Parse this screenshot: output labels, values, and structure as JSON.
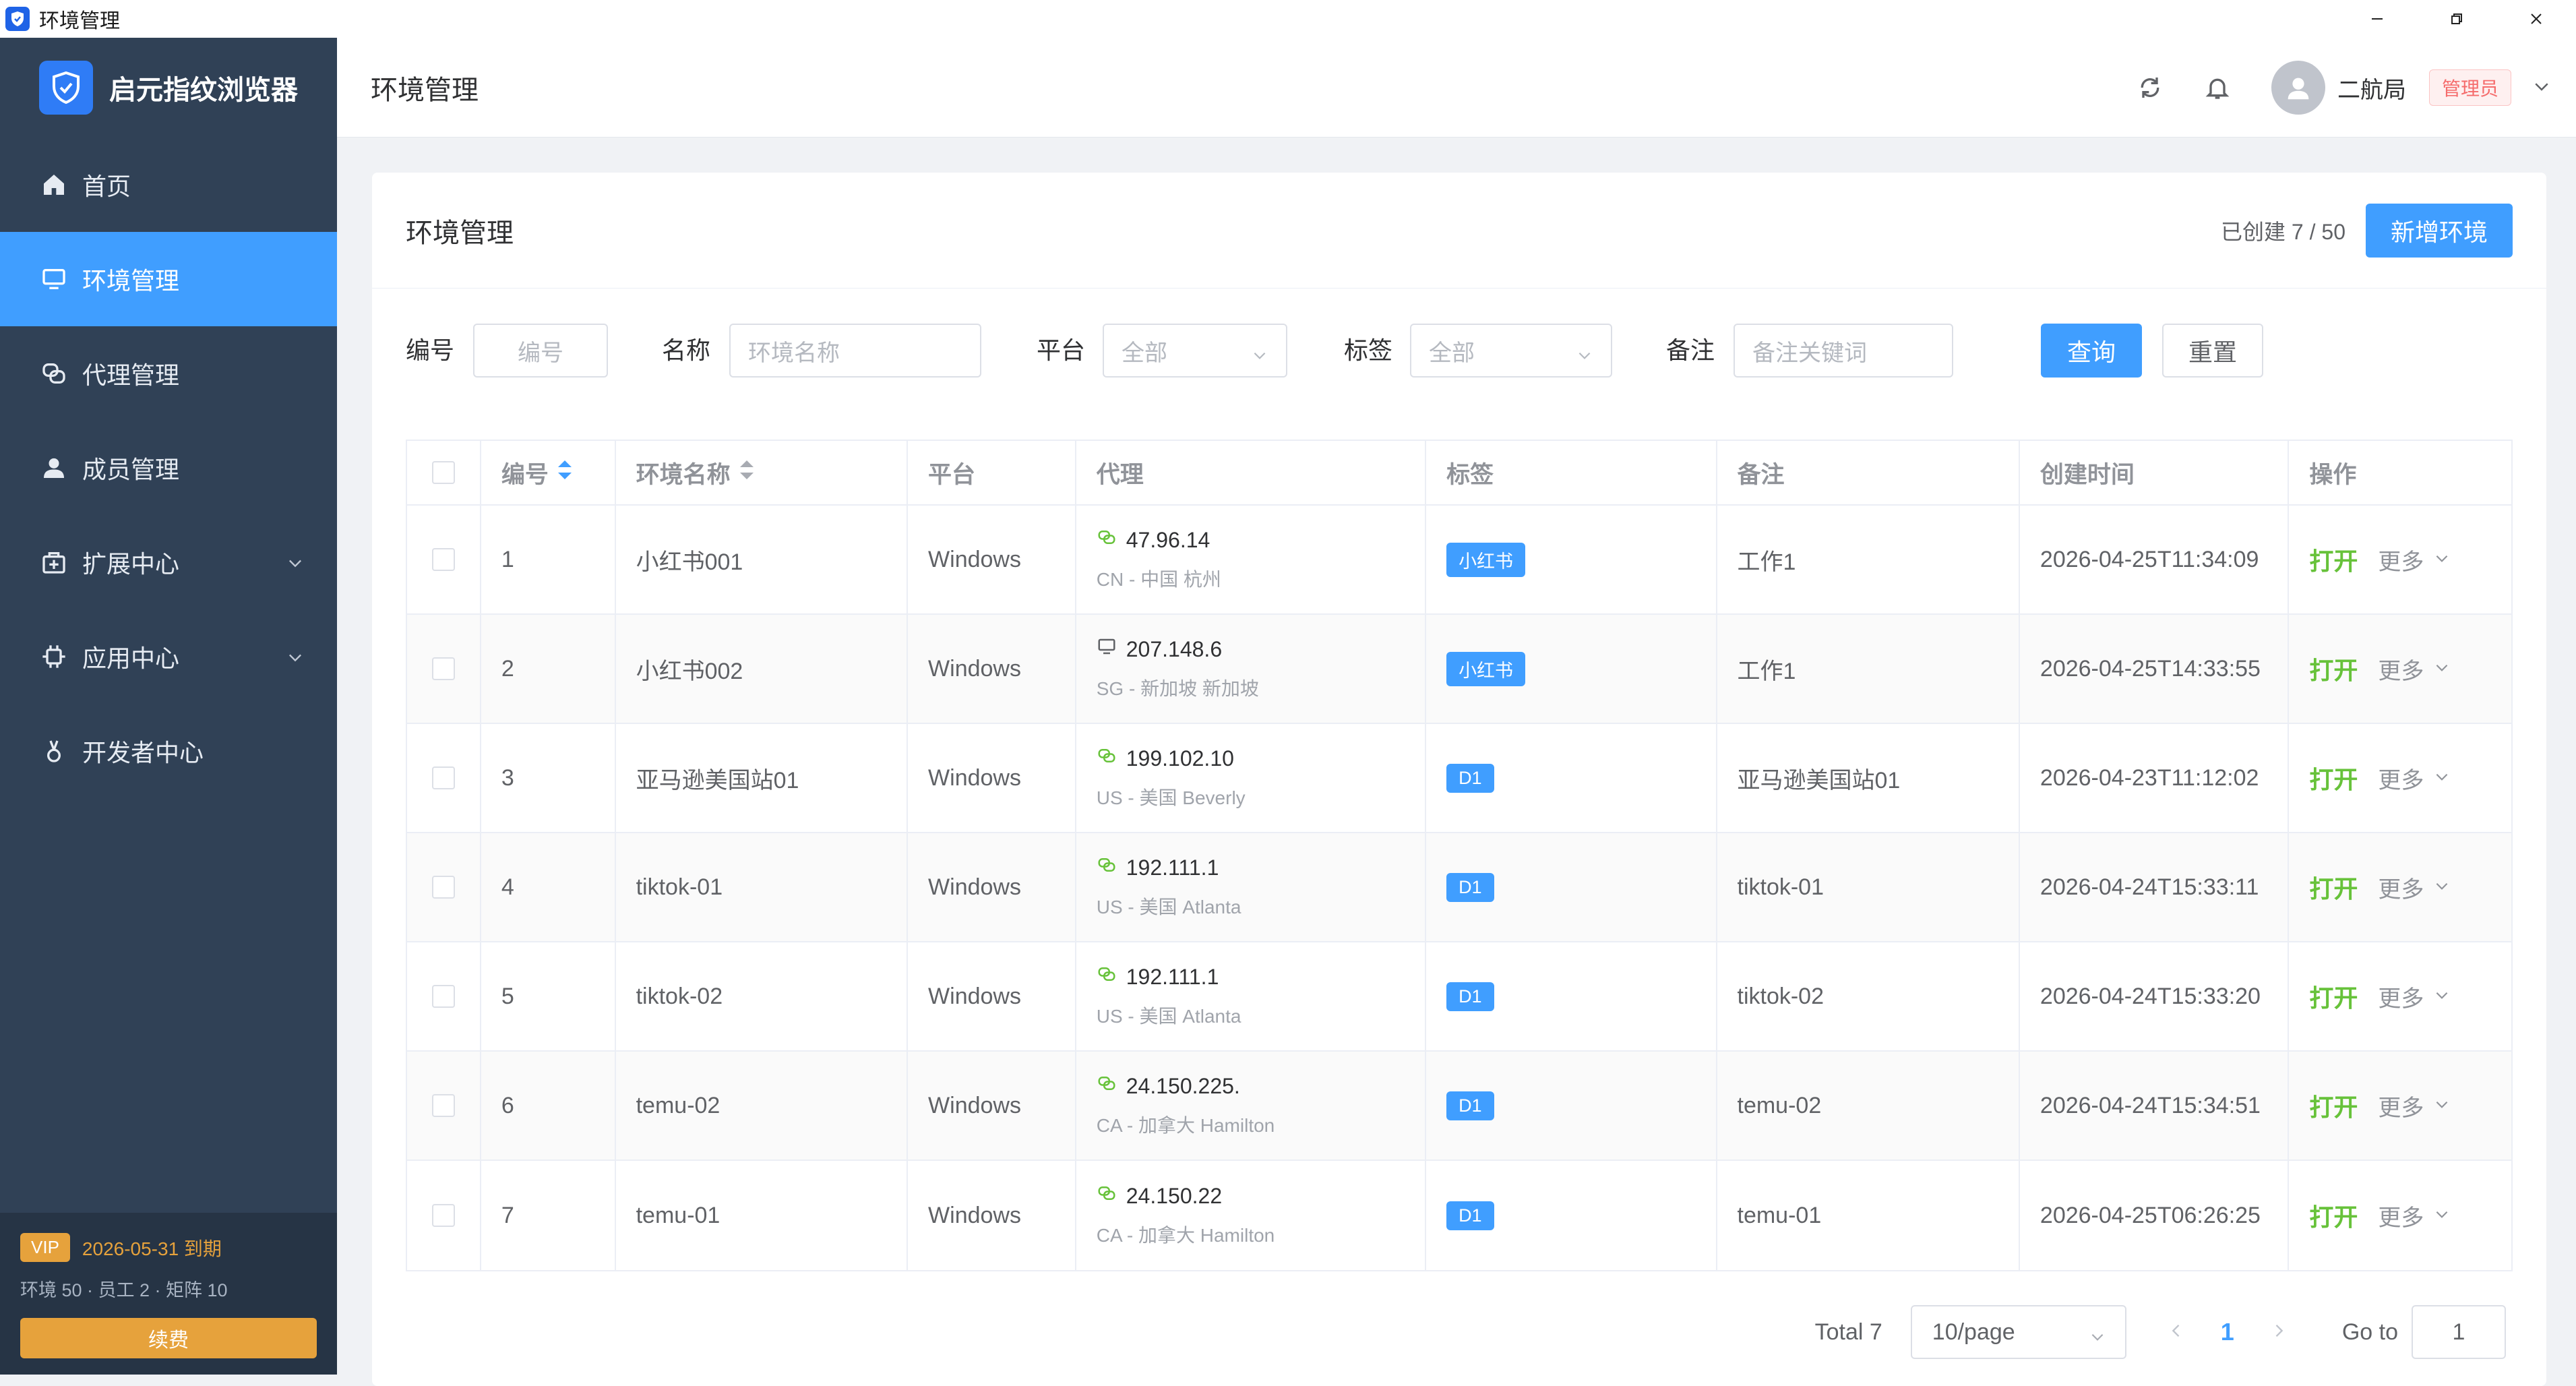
{
  "window": {
    "title": "环境管理"
  },
  "sidebar": {
    "brand": "启元指纹浏览器",
    "items": [
      {
        "label": "首页",
        "icon": "home-icon"
      },
      {
        "label": "环境管理",
        "icon": "monitor-icon",
        "active": true
      },
      {
        "label": "代理管理",
        "icon": "proxy-icon"
      },
      {
        "label": "成员管理",
        "icon": "user-icon"
      },
      {
        "label": "扩展中心",
        "icon": "extension-icon",
        "expandable": true
      },
      {
        "label": "应用中心",
        "icon": "chip-icon",
        "expandable": true
      },
      {
        "label": "开发者中心",
        "icon": "developer-icon"
      }
    ],
    "footer": {
      "vip_badge": "VIP",
      "expiry": "2026-05-31 到期",
      "quota": "环境 50 · 员工 2 · 矩阵 10",
      "renew": "续费"
    }
  },
  "header": {
    "title": "环境管理",
    "username": "二航局",
    "role": "管理员"
  },
  "card": {
    "title": "环境管理",
    "created": "已创建 7 / 50",
    "add_button": "新增环境"
  },
  "filters": {
    "id_label": "编号",
    "id_placeholder": "编号",
    "name_label": "名称",
    "name_placeholder": "环境名称",
    "platform_label": "平台",
    "platform_value": "全部",
    "tag_label": "标签",
    "tag_value": "全部",
    "note_label": "备注",
    "note_placeholder": "备注关键词",
    "query": "查询",
    "reset": "重置"
  },
  "table": {
    "columns": [
      "编号",
      "环境名称",
      "平台",
      "代理",
      "标签",
      "备注",
      "创建时间",
      "操作"
    ],
    "rows": [
      {
        "id": "1",
        "name": "小红书001",
        "platform": "Windows",
        "proxy_ip": "47.96.14",
        "proxy_loc": "CN - 中国 杭州",
        "proxy_icon": "proxy-link-icon",
        "tag": "小红书",
        "note": "工作1",
        "created": "2026-04-25T11:34:09",
        "open": "打开",
        "more": "更多"
      },
      {
        "id": "2",
        "name": "小红书002",
        "platform": "Windows",
        "proxy_ip": "207.148.6",
        "proxy_loc": "SG - 新加坡 新加坡",
        "proxy_icon": "monitor-icon",
        "tag": "小红书",
        "note": "工作1",
        "created": "2026-04-25T14:33:55",
        "open": "打开",
        "more": "更多"
      },
      {
        "id": "3",
        "name": "亚马逊美国站01",
        "platform": "Windows",
        "proxy_ip": "199.102.10",
        "proxy_loc": "US - 美国 Beverly",
        "proxy_icon": "proxy-link-icon",
        "tag": "D1",
        "note": "亚马逊美国站01",
        "created": "2026-04-23T11:12:02",
        "open": "打开",
        "more": "更多"
      },
      {
        "id": "4",
        "name": "tiktok-01",
        "platform": "Windows",
        "proxy_ip": "192.111.1",
        "proxy_loc": "US - 美国 Atlanta",
        "proxy_icon": "proxy-link-icon",
        "tag": "D1",
        "note": "tiktok-01",
        "created": "2026-04-24T15:33:11",
        "open": "打开",
        "more": "更多"
      },
      {
        "id": "5",
        "name": "tiktok-02",
        "platform": "Windows",
        "proxy_ip": "192.111.1",
        "proxy_loc": "US - 美国 Atlanta",
        "proxy_icon": "proxy-link-icon",
        "tag": "D1",
        "note": "tiktok-02",
        "created": "2026-04-24T15:33:20",
        "open": "打开",
        "more": "更多"
      },
      {
        "id": "6",
        "name": "temu-02",
        "platform": "Windows",
        "proxy_ip": "24.150.225.",
        "proxy_loc": "CA - 加拿大 Hamilton",
        "proxy_icon": "proxy-link-icon",
        "tag": "D1",
        "note": "temu-02",
        "created": "2026-04-24T15:34:51",
        "open": "打开",
        "more": "更多"
      },
      {
        "id": "7",
        "name": "temu-01",
        "platform": "Windows",
        "proxy_ip": "24.150.22",
        "proxy_loc": "CA - 加拿大 Hamilton",
        "proxy_icon": "proxy-link-icon",
        "tag": "D1",
        "note": "temu-01",
        "created": "2026-04-25T06:26:25",
        "open": "打开",
        "more": "更多"
      }
    ]
  },
  "pagination": {
    "total": "Total 7",
    "page_size": "10/page",
    "current": "1",
    "goto_label": "Go to",
    "goto_value": "1"
  },
  "colors": {
    "sidebar_bg": "#304156",
    "accent": "#409eff",
    "open_green": "#67c23a",
    "vip_orange": "#e6a23c",
    "role_red": "#f56c6c"
  }
}
